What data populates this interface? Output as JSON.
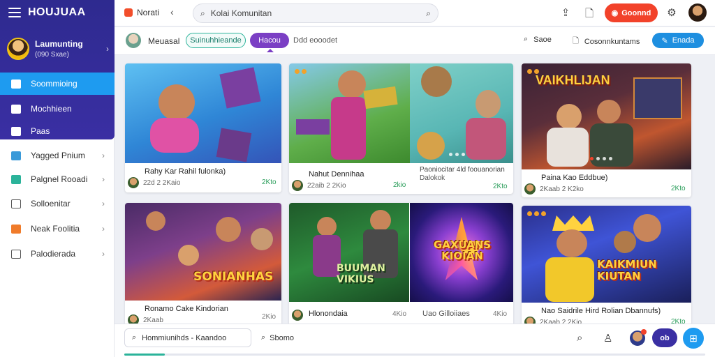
{
  "brand": {
    "name": "HOUJUAA"
  },
  "profile": {
    "name": "Laumunting",
    "sub": "(090 Sxae)"
  },
  "nav_main": [
    {
      "label": "Soommioing",
      "active": true
    },
    {
      "label": "Mochhieen",
      "active": false
    },
    {
      "label": "Paas",
      "active": false
    }
  ],
  "nav_sub": [
    {
      "label": "Yagged Pnium"
    },
    {
      "label": "Palgnel Rooadi"
    },
    {
      "label": "Solloenitar"
    },
    {
      "label": "Neak Foolitia"
    },
    {
      "label": "Palodierada"
    }
  ],
  "header": {
    "logo_label": "Norati",
    "back_icon": "chevron-left-icon",
    "search_value": "Kolai Komunitan",
    "red_button": "Goonnd",
    "colors": {
      "accent": "#1e9bf0",
      "brand": "#3a2fa3",
      "danger": "#f2422a",
      "teal": "#2bb39a"
    }
  },
  "filterbar": {
    "label": "Meuasal",
    "chip_outline": "Suinuhhieande",
    "chip_active": "Hacou",
    "text": "Ddd eooodet",
    "save": "Saoe",
    "sort": "Cosonnkuntams",
    "button": "Enada"
  },
  "cards": [
    {
      "title": "Rahy Kar Rahil fulonka)",
      "meta": "22d 2 2Kaio",
      "count": "2Kto"
    },
    {
      "title": "Nahut Dennihaa",
      "meta": "22aib 2 2Kio",
      "count": "2kio"
    },
    {
      "title": "Paoniocitar 4ld foouanorian",
      "subtitle": "Dalokok",
      "meta": "",
      "count": "2Kto"
    },
    {
      "title": "Paina Kao Eddbue)",
      "meta": "2Kaab 2 K2ko",
      "count": "2Kto"
    },
    {
      "title": "Ronamo Cake Kindorian",
      "meta": "2Kaab",
      "count": "2Kio",
      "overlay": "SONIANHAS"
    },
    {
      "title": "Hlonondaia",
      "meta": "",
      "count": "4Kio",
      "overlay": "BUUMAN VIKIUS"
    },
    {
      "title": "Uao Gilloiiaes",
      "meta": "",
      "count": "4Kio",
      "overlay": "GAXUANS KIOIAN"
    },
    {
      "title": "Nao Saidrile Hird Rolian Dbannufs)",
      "meta": "2Kaab 2 2Kio",
      "count": "2Kto",
      "overlay": "KAIKMIUN KIUTAN"
    }
  ],
  "bottombar": {
    "search_value": "Hommiunihds - Kaandoo",
    "link": "Sbomo",
    "pill": "ob",
    "progress": 0.07
  }
}
